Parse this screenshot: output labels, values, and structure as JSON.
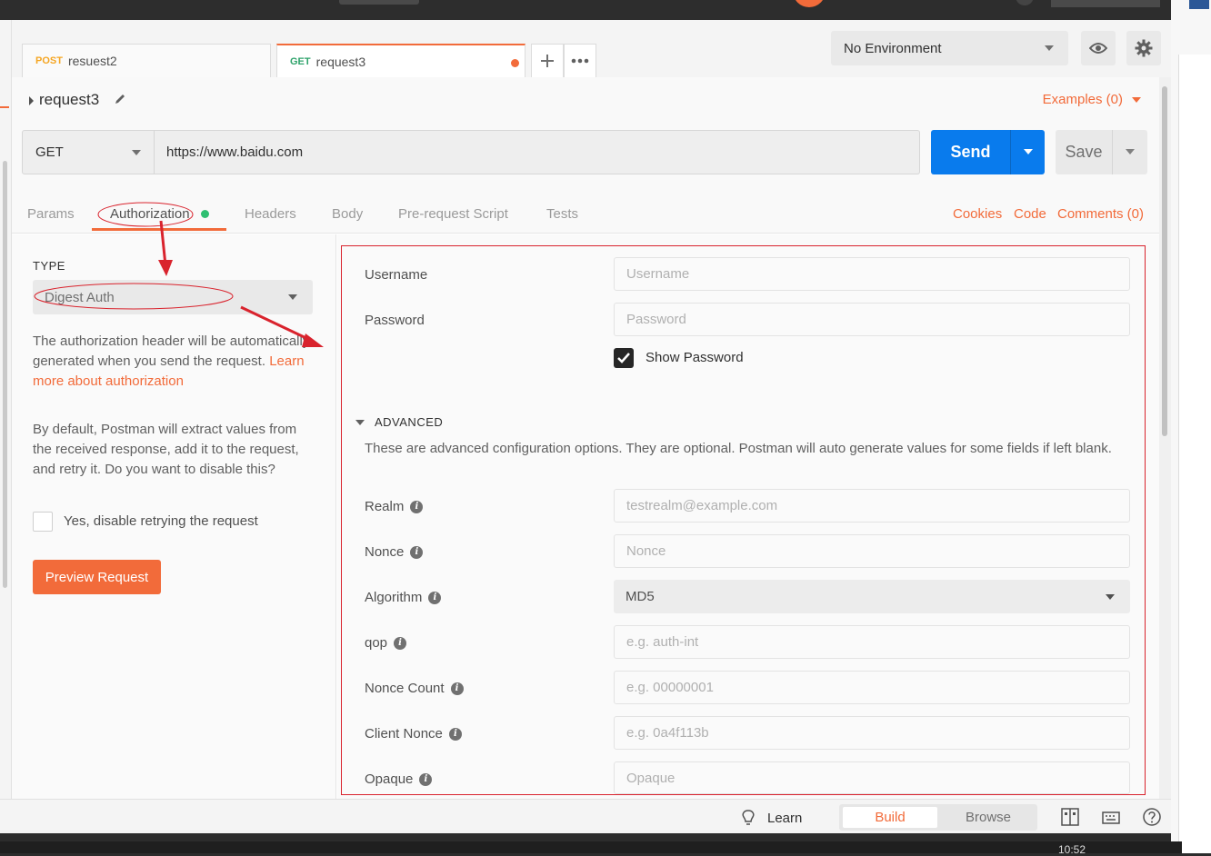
{
  "tabs": [
    {
      "method": "POST",
      "name": "resuest2"
    },
    {
      "method": "GET",
      "name": "request3"
    }
  ],
  "tab_actions": {
    "add_icon": "plus-icon",
    "more_icon": "more-icon"
  },
  "environment": {
    "selected": "No Environment",
    "eye_icon": "eye-icon",
    "settings_icon": "gear-icon"
  },
  "request": {
    "name": "request3",
    "examples_label": "Examples (0)",
    "method": "GET",
    "url": "https://www.baidu.com",
    "send_label": "Send",
    "save_label": "Save"
  },
  "subtabs": {
    "items": [
      "Params",
      "Authorization",
      "Headers",
      "Body",
      "Pre-request Script",
      "Tests"
    ],
    "active": "Authorization",
    "right_links": [
      "Cookies",
      "Code",
      "Comments (0)"
    ]
  },
  "auth_left": {
    "type_label": "TYPE",
    "type_value": "Digest Auth",
    "desc1": "The authorization header will be automatically generated when you send the request.",
    "learn_more": "Learn more about authorization",
    "desc2": "By default, Postman will extract values from the received response, add it to the request, and retry it. Do you want to disable this?",
    "disable_retry_label": "Yes, disable retrying the request",
    "preview_button": "Preview Request"
  },
  "auth_right": {
    "username_label": "Username",
    "username_placeholder": "Username",
    "password_label": "Password",
    "password_placeholder": "Password",
    "show_password_label": "Show Password",
    "show_password_checked": true,
    "advanced_title": "ADVANCED",
    "advanced_desc": "These are advanced configuration options. They are optional. Postman will auto generate values for some fields if left blank.",
    "fields": [
      {
        "label": "Realm",
        "placeholder": "testrealm@example.com"
      },
      {
        "label": "Nonce",
        "placeholder": "Nonce"
      },
      {
        "label": "Algorithm",
        "value": "MD5"
      },
      {
        "label": "qop",
        "placeholder": "e.g. auth-int"
      },
      {
        "label": "Nonce Count",
        "placeholder": "e.g. 00000001"
      },
      {
        "label": "Client Nonce",
        "placeholder": "e.g. 0a4f113b"
      },
      {
        "label": "Opaque",
        "placeholder": "Opaque"
      }
    ]
  },
  "statusbar": {
    "learn_label": "Learn",
    "build_label": "Build",
    "browse_label": "Browse"
  },
  "taskbar": {
    "time": "10:52"
  },
  "colors": {
    "accent": "#f26b3a",
    "send_blue": "#097bed",
    "annotation_red": "#d9232d",
    "green_dot": "#2fbf71"
  }
}
